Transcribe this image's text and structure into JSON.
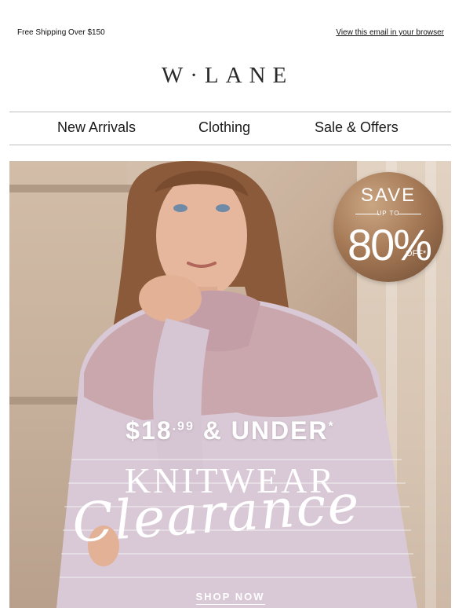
{
  "header": {
    "shipping_text": "Free Shipping Over $150",
    "view_in_browser": "View this email in your browser"
  },
  "brand": {
    "logo_text": "W·LANE"
  },
  "nav": {
    "items": [
      {
        "label": "New Arrivals"
      },
      {
        "label": "Clothing"
      },
      {
        "label": "Sale & Offers"
      }
    ]
  },
  "hero": {
    "badge": {
      "save": "SAVE",
      "up_to": "UP TO",
      "percent": "80%",
      "off": "OFF*"
    },
    "price_main": "$18",
    "price_cents": ".99",
    "price_suffix": " & UNDER",
    "price_asterisk": "*",
    "headline": "KNITWEAR",
    "script_headline": "Clearance",
    "cta": "SHOP NOW"
  },
  "colors": {
    "badge_bronze": "#a67a57",
    "sweater_lilac": "#d8c8d6",
    "sweater_pink": "#c9a8ad"
  }
}
